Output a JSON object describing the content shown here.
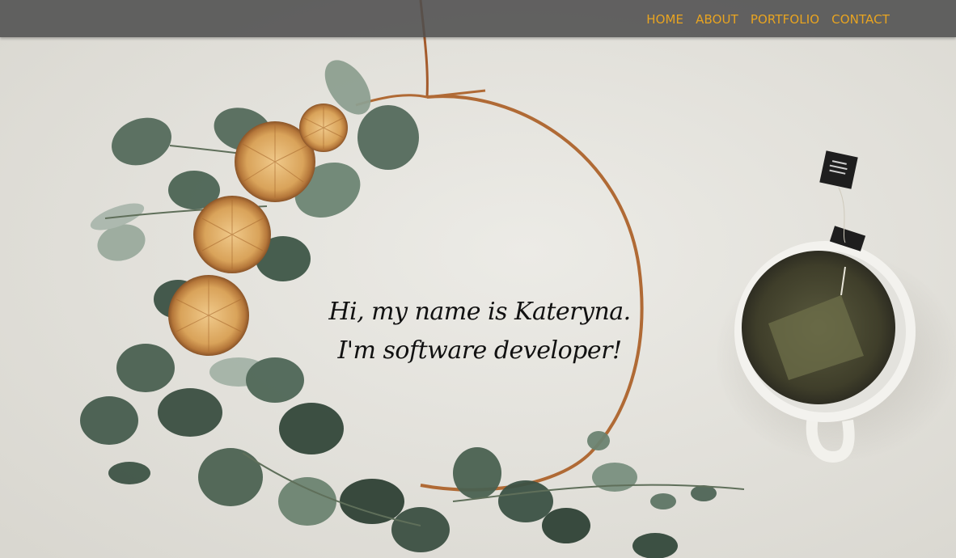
{
  "nav": {
    "items": [
      {
        "label": "HOME"
      },
      {
        "label": "ABOUT"
      },
      {
        "label": "PORTFOLIO"
      },
      {
        "label": "CONTACT"
      }
    ]
  },
  "hero": {
    "line1": "Hi, my name is Kateryna.",
    "line2": "I'm software developer!"
  },
  "colors": {
    "nav_background": "#4e4e4e",
    "nav_link": "#e8a421",
    "hero_text": "#111111",
    "background": "#e6e4de"
  },
  "icons": [
    "tea-bag-tag-icon"
  ]
}
